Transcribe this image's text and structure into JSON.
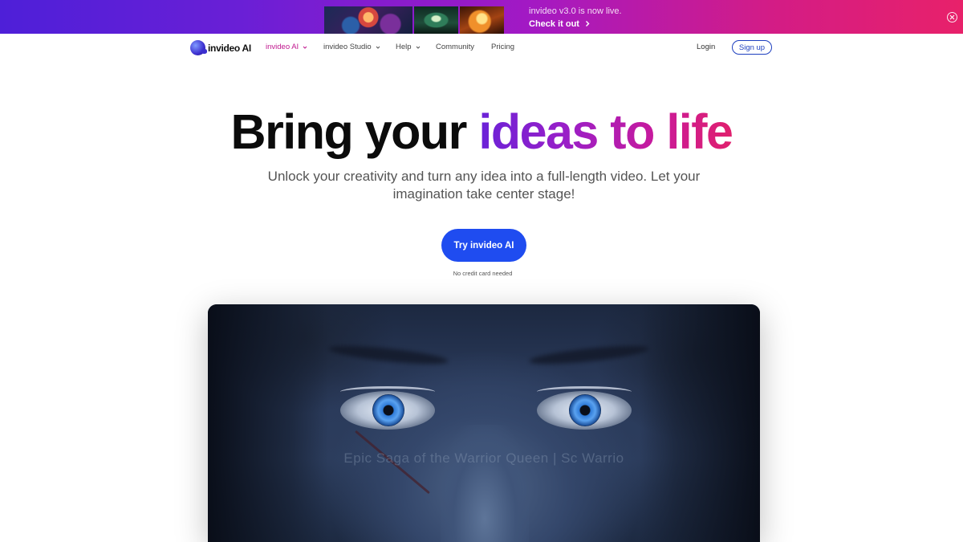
{
  "banner": {
    "message": "invideo v3.0 is now live.",
    "cta": "Check it out",
    "icons": {
      "cta_arrow": "chevron-right-icon",
      "close": "close-circle-icon"
    }
  },
  "nav": {
    "logo_text": "invideo AI",
    "items": [
      {
        "label": "invideo AI",
        "has_dropdown": true,
        "active": true
      },
      {
        "label": "invideo Studio",
        "has_dropdown": true,
        "active": false
      },
      {
        "label": "Help",
        "has_dropdown": true,
        "active": false
      },
      {
        "label": "Community",
        "has_dropdown": false,
        "active": false
      },
      {
        "label": "Pricing",
        "has_dropdown": false,
        "active": false
      }
    ],
    "login": "Login",
    "signup": "Sign up"
  },
  "hero": {
    "headline_plain": "Bring your",
    "headline_gradient": "ideas to life",
    "subtitle": "Unlock your creativity and turn any idea into a full-length video. Let your imagination take center stage!",
    "cta": "Try invideo AI",
    "note": "No credit card needed"
  },
  "video": {
    "caption": "Epic Saga of the Warrior Queen | Sc Warrio"
  },
  "colors": {
    "banner_gradient_start": "#4e1fd8",
    "banner_gradient_end": "#e8216a",
    "nav_active": "#c0178e",
    "headline_gradient_start": "#6a22d8",
    "headline_gradient_end": "#e0206e",
    "cta_blue": "#1f4cf0",
    "signup_border": "#1d3fbf"
  }
}
